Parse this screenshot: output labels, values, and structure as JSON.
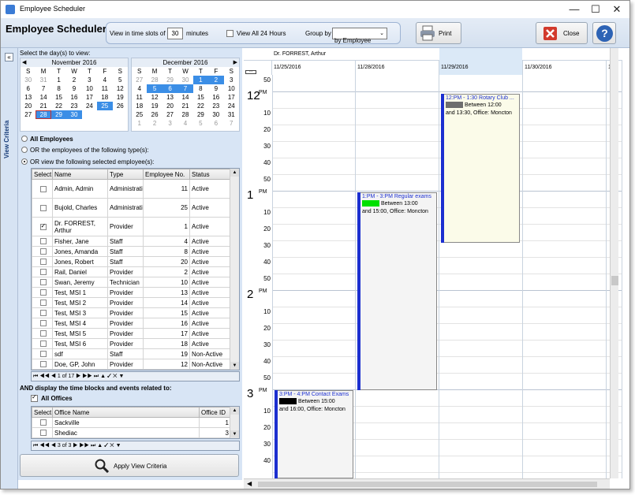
{
  "window": {
    "title": "Employee Scheduler",
    "min": "—",
    "max": "☐",
    "close": "✕"
  },
  "toolbar": {
    "app_title": "Employee Scheduler",
    "time_slot_label": "View in time slots of",
    "time_slot_value": "30",
    "minutes_label": "minutes",
    "view_all_label": "View All 24 Hours",
    "group_by_label": "Group by",
    "group_by_value": "by Employee",
    "print_label": "Print",
    "close_label": "Close",
    "help_label": "?"
  },
  "left": {
    "vertical_tab": "View Criteria",
    "collapse": "«",
    "select_days_label": "Select the day(s) to view:",
    "cal1": {
      "title": "November 2016",
      "dow": [
        "S",
        "M",
        "T",
        "W",
        "T",
        "F",
        "S"
      ],
      "weeks": [
        [
          "30",
          "31",
          "1",
          "2",
          "3",
          "4",
          "5"
        ],
        [
          "6",
          "7",
          "8",
          "9",
          "10",
          "11",
          "12"
        ],
        [
          "13",
          "14",
          "15",
          "16",
          "17",
          "18",
          "19"
        ],
        [
          "20",
          "21",
          "22",
          "23",
          "24",
          "25",
          "26"
        ],
        [
          "27",
          "28",
          "29",
          "30",
          "",
          "",
          ""
        ]
      ]
    },
    "cal2": {
      "title": "December 2016",
      "dow": [
        "S",
        "M",
        "T",
        "W",
        "T",
        "F",
        "S"
      ],
      "weeks": [
        [
          "27",
          "28",
          "29",
          "30",
          "1",
          "2",
          "3"
        ],
        [
          "4",
          "5",
          "6",
          "7",
          "8",
          "9",
          "10"
        ],
        [
          "11",
          "12",
          "13",
          "14",
          "15",
          "16",
          "17"
        ],
        [
          "18",
          "19",
          "20",
          "21",
          "22",
          "23",
          "24"
        ],
        [
          "25",
          "26",
          "27",
          "28",
          "29",
          "30",
          "31"
        ],
        [
          "1",
          "2",
          "3",
          "4",
          "5",
          "6",
          "7"
        ]
      ]
    },
    "radio_all": "All Employees",
    "radio_types": "OR the employees of the following type(s):",
    "radio_selected": "OR view the following selected employee(s):",
    "emp_headers": [
      "Select",
      "Name",
      "Type",
      "Employee No.",
      "Status"
    ],
    "employees": [
      {
        "name": "Admin, Admin",
        "type": "Administration",
        "no": "11",
        "status": "Active",
        "checked": false
      },
      {
        "name": "Bujold, Charles",
        "type": "Administration",
        "no": "25",
        "status": "Active",
        "checked": false
      },
      {
        "name": "Dr. FORREST, Arthur",
        "type": "Provider",
        "no": "1",
        "status": "Active",
        "checked": true
      },
      {
        "name": "Fisher, Jane",
        "type": "Staff",
        "no": "4",
        "status": "Active",
        "checked": false
      },
      {
        "name": "Jones, Amanda",
        "type": "Staff",
        "no": "8",
        "status": "Active",
        "checked": false
      },
      {
        "name": "Jones, Robert",
        "type": "Staff",
        "no": "20",
        "status": "Active",
        "checked": false
      },
      {
        "name": "Rail, Daniel",
        "type": "Provider",
        "no": "2",
        "status": "Active",
        "checked": false
      },
      {
        "name": "Swan, Jeremy",
        "type": "Technician",
        "no": "10",
        "status": "Active",
        "checked": false
      },
      {
        "name": "Test, MSI 1",
        "type": "Provider",
        "no": "13",
        "status": "Active",
        "checked": false
      },
      {
        "name": "Test, MSI 2",
        "type": "Provider",
        "no": "14",
        "status": "Active",
        "checked": false
      },
      {
        "name": "Test, MSI 3",
        "type": "Provider",
        "no": "15",
        "status": "Active",
        "checked": false
      },
      {
        "name": "Test, MSI 4",
        "type": "Provider",
        "no": "16",
        "status": "Active",
        "checked": false
      },
      {
        "name": "Test, MSI 5",
        "type": "Provider",
        "no": "17",
        "status": "Active",
        "checked": false
      },
      {
        "name": "Test, MSI 6",
        "type": "Provider",
        "no": "18",
        "status": "Active",
        "checked": false
      },
      {
        "name": "sdf",
        "type": "Staff",
        "no": "19",
        "status": "Non-Active",
        "checked": false
      },
      {
        "name": "Doe, GP, John",
        "type": "Provider",
        "no": "12",
        "status": "Non-Active",
        "checked": false
      }
    ],
    "emp_nav": "⏮ ◀◀ ◀  1 of 17  ▶ ▶▶ ⏭ ▲ ✓ ✕ ▼",
    "and_display_label": "AND display the time blocks and events related to:",
    "all_offices": "All Offices",
    "office_headers": [
      "Select",
      "Office Name",
      "Office ID"
    ],
    "offices": [
      {
        "name": "Sackville",
        "id": "1"
      },
      {
        "name": "Shediac",
        "id": "3"
      }
    ],
    "office_nav": "⏮ ◀◀ ◀  3 of 3  ▶ ▶▶ ⏭ ▲ ✓ ✕ ▼",
    "apply_label": "Apply View Criteria"
  },
  "schedule": {
    "employee": "Dr. FORREST, Arthur",
    "dates": [
      "11/25/2016",
      "11/28/2016",
      "11/29/2016",
      "11/30/2016",
      "1..."
    ],
    "hours": [
      {
        "h": "12",
        "pm": "PM"
      },
      {
        "h": "1",
        "pm": "PM"
      },
      {
        "h": "2",
        "pm": "PM"
      },
      {
        "h": "3",
        "pm": "PM"
      }
    ],
    "top_minute": "50",
    "minutes": [
      "10",
      "20",
      "30",
      "40",
      "50"
    ],
    "events": [
      {
        "title": "1:PM - 3:PM Regular exams",
        "l1": "Between 13:00",
        "l2": "and 15:00, Office: Moncton",
        "color": "#00e000",
        "bar": "#1c2fd0"
      },
      {
        "title": "12:PM - 1:30 Rotary Club ...",
        "l1": "Between 12:00",
        "l2": "and 13:30, Office: Moncton",
        "color": "#6e6e6e",
        "bar": "#1c2fd0"
      },
      {
        "title": "3:PM - 4:PM Contact Exams",
        "l1": "Between 15:00",
        "l2": "and 16:00, Office: Moncton",
        "color": "#000000",
        "bar": "#1c2fd0"
      }
    ]
  }
}
